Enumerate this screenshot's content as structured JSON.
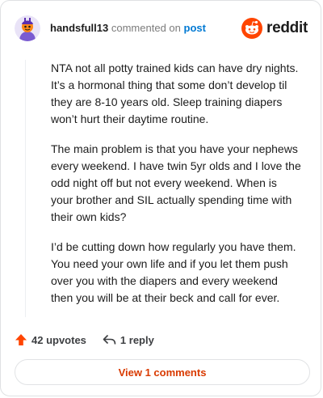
{
  "comment": {
    "username": "handsfull13",
    "action_text": "commented on",
    "target_link": "post",
    "brand": "reddit",
    "paragraphs": [
      "NTA not all potty trained kids can have dry nights. It’s a hormonal thing that some don’t develop til they are 8-10 years old. Sleep training diapers won’t hurt their daytime routine.",
      "The main problem is that you have your nephews every weekend. I have twin 5yr olds and I love the odd night off but not every weekend. When is your brother and SIL actually spending time with their own kids?",
      "I’d be cutting down how regularly you have them. You need your own life and if you let them push over you with the diapers and every weekend then you will be at their beck and call for ever."
    ],
    "upvotes_label": "42 upvotes",
    "replies_label": "1 reply",
    "view_comments_label": "View 1 comments"
  },
  "colors": {
    "accent": "#ff4500",
    "link": "#0079d3",
    "view_button_text": "#d93a00"
  },
  "icons": {
    "avatar": "snoo-avatar-icon",
    "brand_logo": "reddit-logo-icon",
    "upvote": "upvote-arrow-icon",
    "reply": "reply-arrow-icon"
  }
}
